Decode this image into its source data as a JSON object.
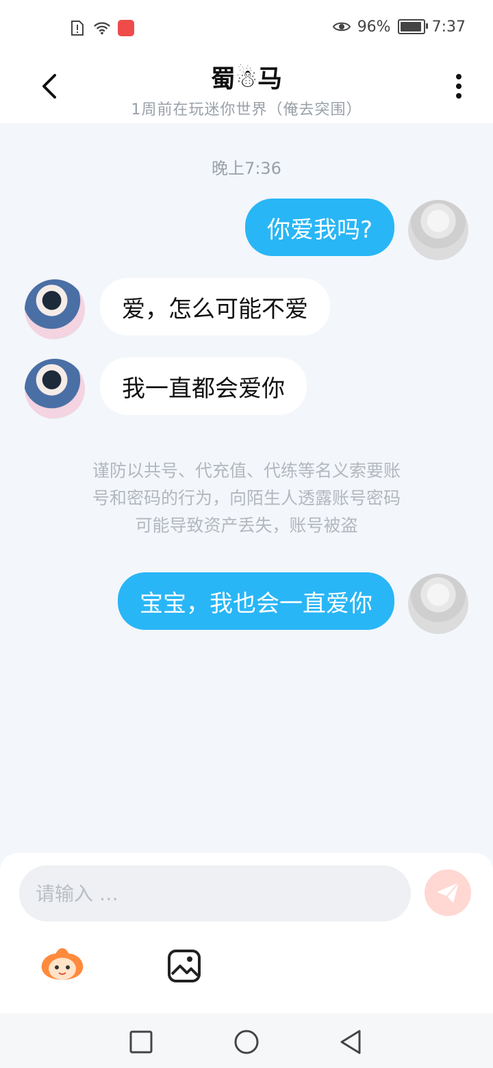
{
  "status_bar": {
    "battery_text": "96%",
    "time": "7:37",
    "battery_level": 0.96
  },
  "header": {
    "title": "蜀☃马",
    "subtitle": "1周前在玩迷你世界（俺去突围）"
  },
  "chat": {
    "time_label": "晚上7:36",
    "messages": [
      {
        "side": "out",
        "text": "你爱我吗?"
      },
      {
        "side": "in",
        "text": "爱，怎么可能不爱"
      },
      {
        "side": "in",
        "text": "我一直都会爱你"
      },
      {
        "side": "out",
        "text": "宝宝，我也会一直爱你"
      }
    ],
    "notice_lines": [
      "谨防以共号、代充值、代练等名义索要账",
      "号和密码的行为，向陌生人透露账号密码",
      "可能导致资产丢失，账号被盗"
    ]
  },
  "composer": {
    "placeholder": "请输入 …"
  },
  "colors": {
    "bubble_out": "#29b6f6",
    "bubble_in": "#ffffff",
    "background": "#f3f6fa",
    "send_button": "#ffd7d3"
  },
  "icons": [
    "back-arrow-icon",
    "more-vertical-icon",
    "send-icon",
    "emoji-character-icon",
    "image-icon",
    "home-square-icon",
    "circle-home-icon",
    "back-triangle-icon"
  ]
}
